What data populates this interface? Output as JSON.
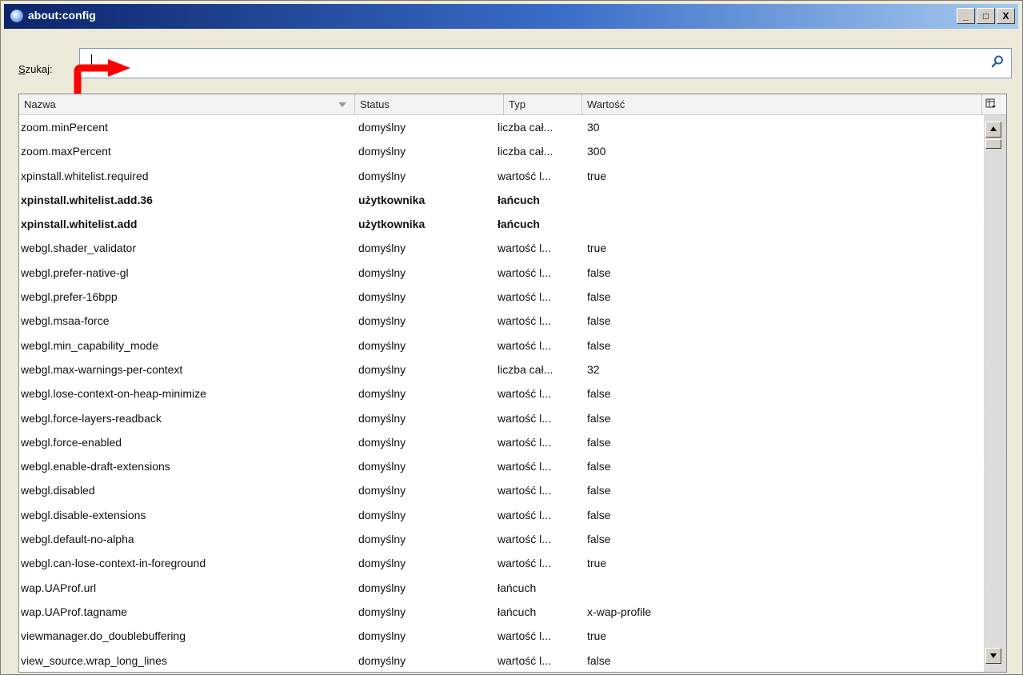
{
  "window": {
    "title": "about:config",
    "minimize_glyph": "_",
    "maximize_glyph": "□",
    "close_glyph": "X"
  },
  "search": {
    "label_underlined": "S",
    "label_rest": "zukaj:",
    "value": "",
    "placeholder": "",
    "icon": "search-icon"
  },
  "table": {
    "columns": [
      "Nazwa",
      "Status",
      "Typ",
      "Wartość"
    ],
    "rows": [
      {
        "name": "zoom.minPercent",
        "status": "domyślny",
        "type": "liczba cał...",
        "value": "30",
        "bold": false
      },
      {
        "name": "zoom.maxPercent",
        "status": "domyślny",
        "type": "liczba cał...",
        "value": "300",
        "bold": false
      },
      {
        "name": "xpinstall.whitelist.required",
        "status": "domyślny",
        "type": "wartość l...",
        "value": "true",
        "bold": false
      },
      {
        "name": "xpinstall.whitelist.add.36",
        "status": "użytkownika",
        "type": "łańcuch",
        "value": "",
        "bold": true
      },
      {
        "name": "xpinstall.whitelist.add",
        "status": "użytkownika",
        "type": "łańcuch",
        "value": "",
        "bold": true
      },
      {
        "name": "webgl.shader_validator",
        "status": "domyślny",
        "type": "wartość l...",
        "value": "true",
        "bold": false
      },
      {
        "name": "webgl.prefer-native-gl",
        "status": "domyślny",
        "type": "wartość l...",
        "value": "false",
        "bold": false
      },
      {
        "name": "webgl.prefer-16bpp",
        "status": "domyślny",
        "type": "wartość l...",
        "value": "false",
        "bold": false
      },
      {
        "name": "webgl.msaa-force",
        "status": "domyślny",
        "type": "wartość l...",
        "value": "false",
        "bold": false
      },
      {
        "name": "webgl.min_capability_mode",
        "status": "domyślny",
        "type": "wartość l...",
        "value": "false",
        "bold": false
      },
      {
        "name": "webgl.max-warnings-per-context",
        "status": "domyślny",
        "type": "liczba cał...",
        "value": "32",
        "bold": false
      },
      {
        "name": "webgl.lose-context-on-heap-minimize",
        "status": "domyślny",
        "type": "wartość l...",
        "value": "false",
        "bold": false
      },
      {
        "name": "webgl.force-layers-readback",
        "status": "domyślny",
        "type": "wartość l...",
        "value": "false",
        "bold": false
      },
      {
        "name": "webgl.force-enabled",
        "status": "domyślny",
        "type": "wartość l...",
        "value": "false",
        "bold": false
      },
      {
        "name": "webgl.enable-draft-extensions",
        "status": "domyślny",
        "type": "wartość l...",
        "value": "false",
        "bold": false
      },
      {
        "name": "webgl.disabled",
        "status": "domyślny",
        "type": "wartość l...",
        "value": "false",
        "bold": false
      },
      {
        "name": "webgl.disable-extensions",
        "status": "domyślny",
        "type": "wartość l...",
        "value": "false",
        "bold": false
      },
      {
        "name": "webgl.default-no-alpha",
        "status": "domyślny",
        "type": "wartość l...",
        "value": "false",
        "bold": false
      },
      {
        "name": "webgl.can-lose-context-in-foreground",
        "status": "domyślny",
        "type": "wartość l...",
        "value": "true",
        "bold": false
      },
      {
        "name": "wap.UAProf.url",
        "status": "domyślny",
        "type": "łańcuch",
        "value": "",
        "bold": false
      },
      {
        "name": "wap.UAProf.tagname",
        "status": "domyślny",
        "type": "łańcuch",
        "value": "x-wap-profile",
        "bold": false
      },
      {
        "name": "viewmanager.do_doublebuffering",
        "status": "domyślny",
        "type": "wartość l...",
        "value": "true",
        "bold": false
      },
      {
        "name": "view_source.wrap_long_lines",
        "status": "domyślny",
        "type": "wartość l...",
        "value": "false",
        "bold": false
      }
    ]
  },
  "colors": {
    "titlebar_start": "#0b246a",
    "titlebar_end": "#a6caf0",
    "annotation_arrow": "#ff0000"
  }
}
